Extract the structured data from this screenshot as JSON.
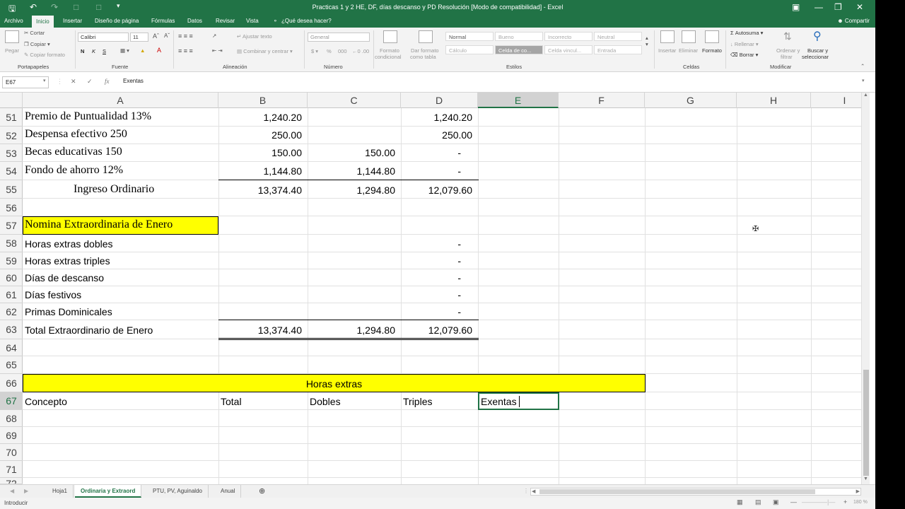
{
  "window": {
    "title": "Practicas 1 y 2 HE, DF, días descanso y PD Resolución  [Modo de compatibilidad] - Excel"
  },
  "ribbon_tabs": [
    "Archivo",
    "Inicio",
    "Insertar",
    "Diseño de página",
    "Fórmulas",
    "Datos",
    "Revisar",
    "Vista"
  ],
  "tell_me": "¿Qué desea hacer?",
  "share": "Compartir",
  "ribbon": {
    "paste": "Pegar",
    "cut": "Cortar",
    "copy": "Copiar",
    "format_painter": "Copiar formato",
    "clipboard_group": "Portapapeles",
    "font_name": "Calibri",
    "font_size": "11",
    "bold": "N",
    "italic": "K",
    "underline": "S",
    "font_group": "Fuente",
    "wrap_text": "Ajustar texto",
    "merge_center": "Combinar y centrar",
    "alignment_group": "Alineación",
    "number_format": "General",
    "number_group": "Número",
    "cond_format_1": "Formato",
    "cond_format_2": "condicional",
    "table_format_1": "Dar formato",
    "table_format_2": "como tabla",
    "styles": [
      "Normal",
      "Bueno",
      "Incorrecto",
      "Neutral",
      "Cálculo",
      "Celda de co...",
      "Celda vincul...",
      "Entrada"
    ],
    "styles_group": "Estilos",
    "insert": "Insertar",
    "delete": "Eliminar",
    "format": "Formato",
    "cells_group": "Celdas",
    "autosum": "Autosuma",
    "fill": "Rellenar",
    "clear": "Borrar",
    "sort_1": "Ordenar y",
    "sort_2": "filtrar",
    "find_1": "Buscar y",
    "find_2": "seleccionar",
    "editing_group": "Modificar"
  },
  "formula_bar": {
    "name_box": "E67",
    "formula": "Exentas"
  },
  "columns": [
    "A",
    "B",
    "C",
    "D",
    "E",
    "F",
    "G",
    "H",
    "I"
  ],
  "rows": [
    "51",
    "52",
    "53",
    "54",
    "55",
    "56",
    "57",
    "58",
    "59",
    "60",
    "61",
    "62",
    "63",
    "64",
    "65",
    "66",
    "67",
    "68",
    "69",
    "70",
    "71",
    "72"
  ],
  "cells": {
    "a51": "Premio de Puntualidad 13%",
    "b51": "1,240.20",
    "d51": "1,240.20",
    "a52": "Despensa efectivo 250",
    "b52": "250.00",
    "d52": "250.00",
    "a53": "Becas educativas 150",
    "b53": "150.00",
    "c53": "150.00",
    "d53": "-",
    "a54": "Fondo de ahorro 12%",
    "b54": "1,144.80",
    "c54": "1,144.80",
    "d54": "-",
    "a55": "Ingreso Ordinario",
    "b55": "13,374.40",
    "c55": "1,294.80",
    "d55": "12,079.60",
    "a57": "Nomina Extraordinaria de Enero",
    "a58": "Horas extras dobles",
    "d58": "-",
    "a59": "Horas extras triples",
    "d59": "-",
    "a60": "Días de descanso",
    "d60": "-",
    "a61": "Días festivos",
    "d61": "-",
    "a62": "Primas Dominicales",
    "d62": "-",
    "a63": "Total Extraordinario de Enero",
    "b63": "13,374.40",
    "c63": "1,294.80",
    "d63": "12,079.60",
    "merged66": "Horas extras",
    "a67": "Concepto",
    "b67": "Total",
    "c67": "Dobles",
    "d67": "Triples",
    "e67": "Exentas"
  },
  "sheets": [
    "Hoja1",
    "Ordinaria y Extraord",
    "PTU, PV, Aguinaldo",
    "Anual"
  ],
  "active_sheet": "Ordinaria y Extraord",
  "status": {
    "mode": "Introducir",
    "zoom": "180 %"
  },
  "colors": {
    "excel_green": "#217346",
    "highlight_yellow": "#ffff00"
  }
}
